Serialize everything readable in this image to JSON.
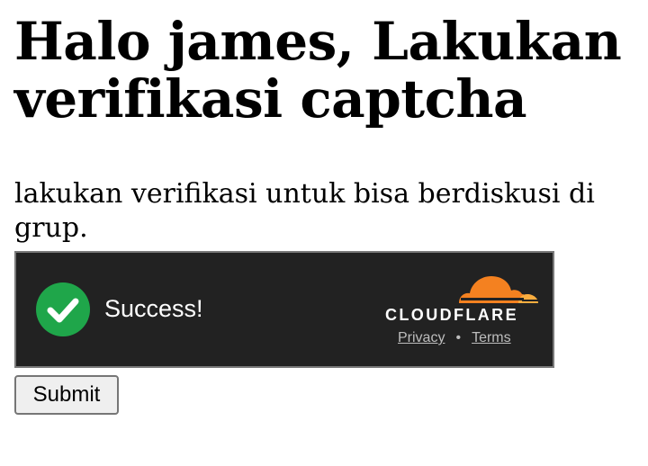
{
  "heading": {
    "title": "Halo james, Lakukan verifikasi captcha"
  },
  "description": {
    "text": "lakukan verifikasi untuk bisa berdiskusi di grup."
  },
  "captcha": {
    "status_text": "Success!",
    "brand": "CLOUDFLARE",
    "privacy_link": "Privacy",
    "separator": "•",
    "terms_link": "Terms",
    "status_icon": "check-circle-icon",
    "logo_icon": "cloudflare-cloud-logo",
    "colors": {
      "background": "#222222",
      "success": "#1fa64a",
      "brand_orange": "#f48120",
      "brand_orange_light": "#faad3f"
    }
  },
  "form": {
    "submit_label": "Submit"
  }
}
